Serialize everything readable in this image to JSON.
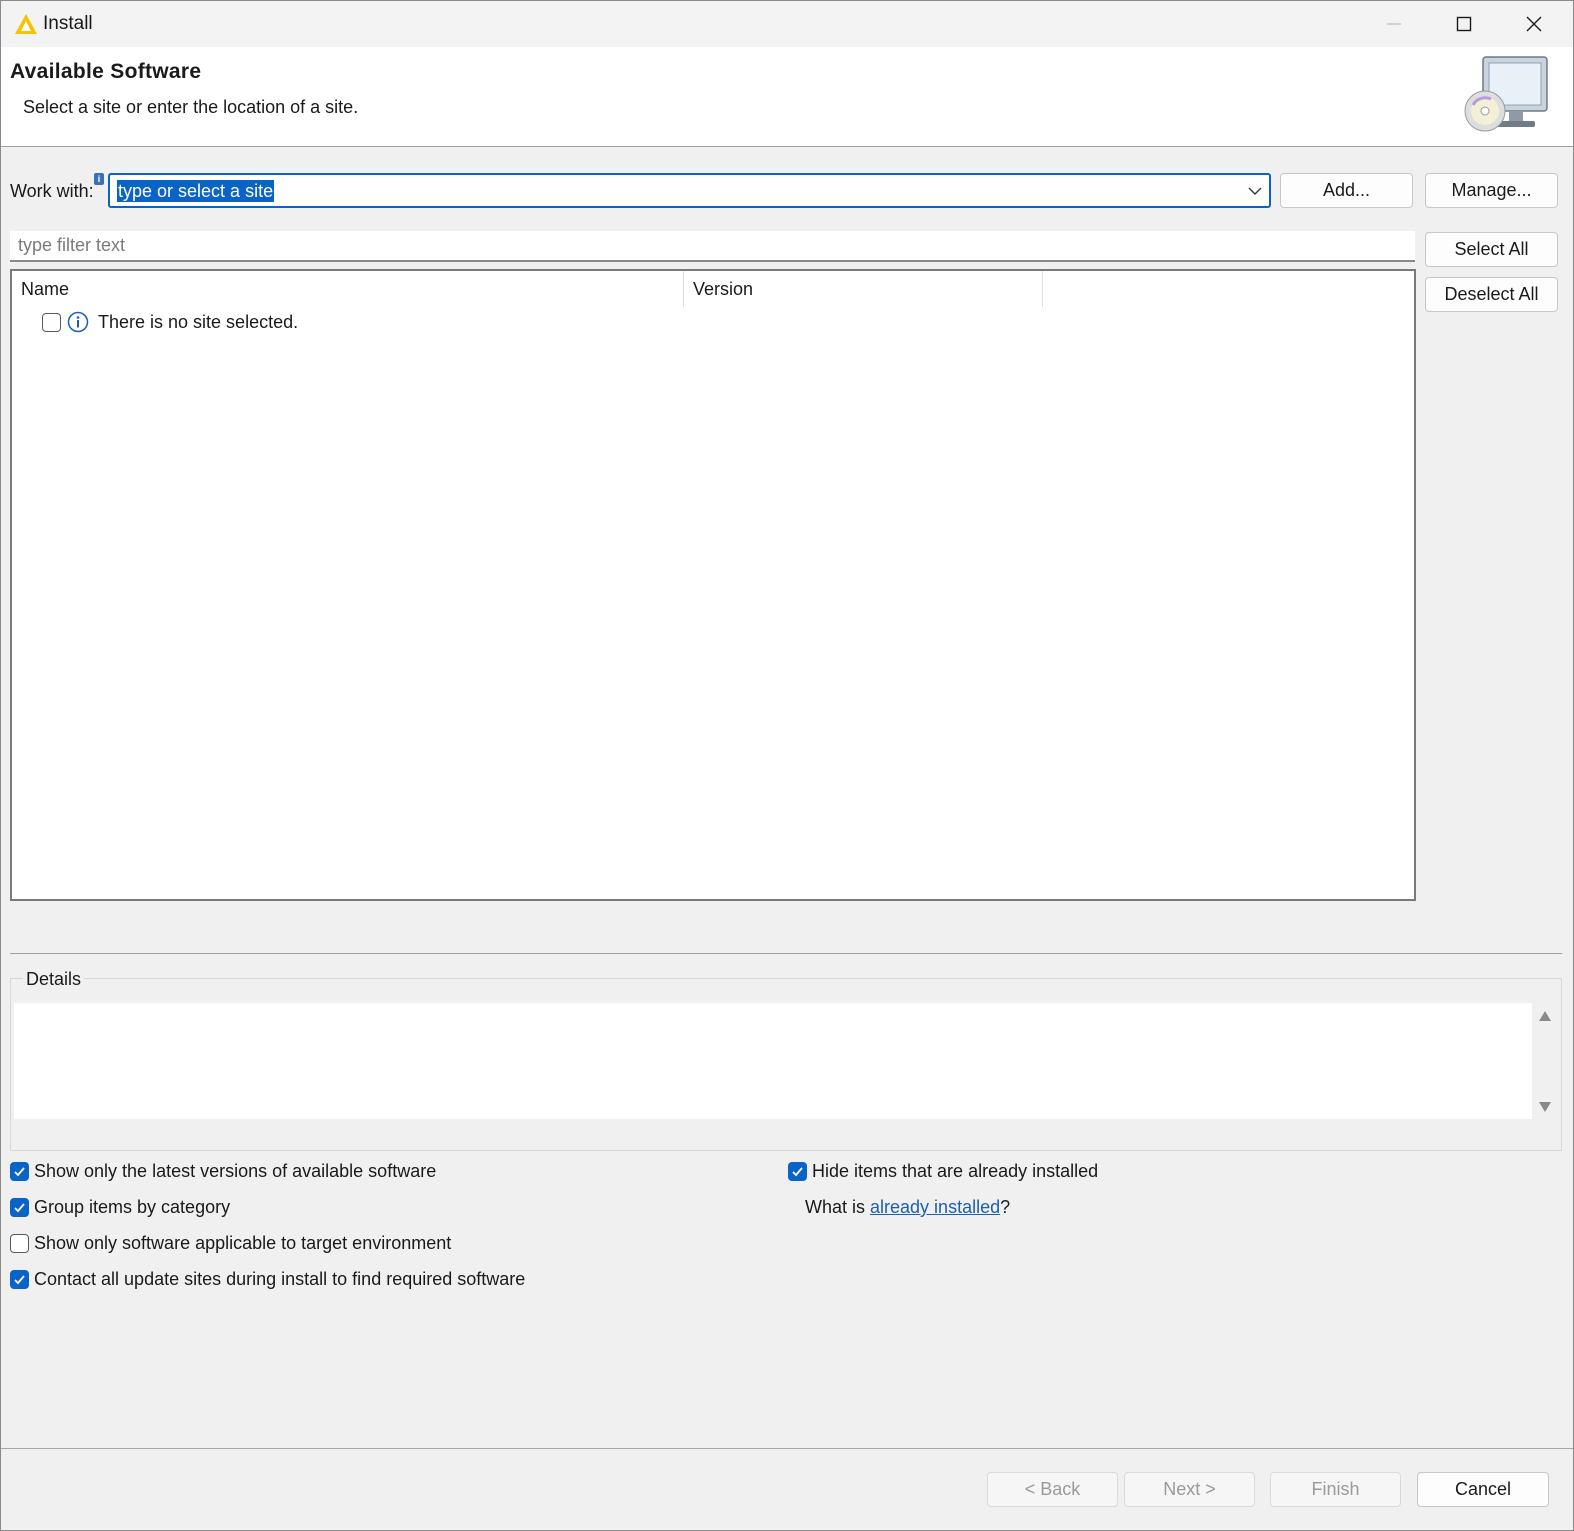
{
  "window": {
    "title": "Install",
    "accent_color": "#0a64c8"
  },
  "banner": {
    "title": "Available Software",
    "subtitle": "Select a site or enter the location of a site."
  },
  "work_with": {
    "label": "Work with:",
    "value": "type or select a site",
    "add_label": "Add...",
    "manage_label": "Manage..."
  },
  "filter": {
    "placeholder": "type filter text"
  },
  "selection": {
    "select_all_label": "Select All",
    "deselect_all_label": "Deselect All"
  },
  "tree": {
    "columns": [
      "Name",
      "Version"
    ],
    "rows": [
      {
        "text": "There is no site selected.",
        "checked": false,
        "icon": "info-icon"
      }
    ]
  },
  "details": {
    "label": "Details"
  },
  "options": {
    "show_latest": {
      "label": "Show only the latest versions of available software",
      "checked": true
    },
    "group_by_category": {
      "label": "Group items by category",
      "checked": true
    },
    "applicable_only": {
      "label": "Show only software applicable to target environment",
      "checked": false
    },
    "contact_all": {
      "label": "Contact all update sites during install to find required software",
      "checked": true
    },
    "hide_installed": {
      "label": "Hide items that are already installed",
      "checked": true
    },
    "what_is_prefix": "What is ",
    "what_is_link": "already installed",
    "what_is_suffix": "?"
  },
  "footer": {
    "back_label": "< Back",
    "next_label": "Next >",
    "finish_label": "Finish",
    "cancel_label": "Cancel"
  }
}
